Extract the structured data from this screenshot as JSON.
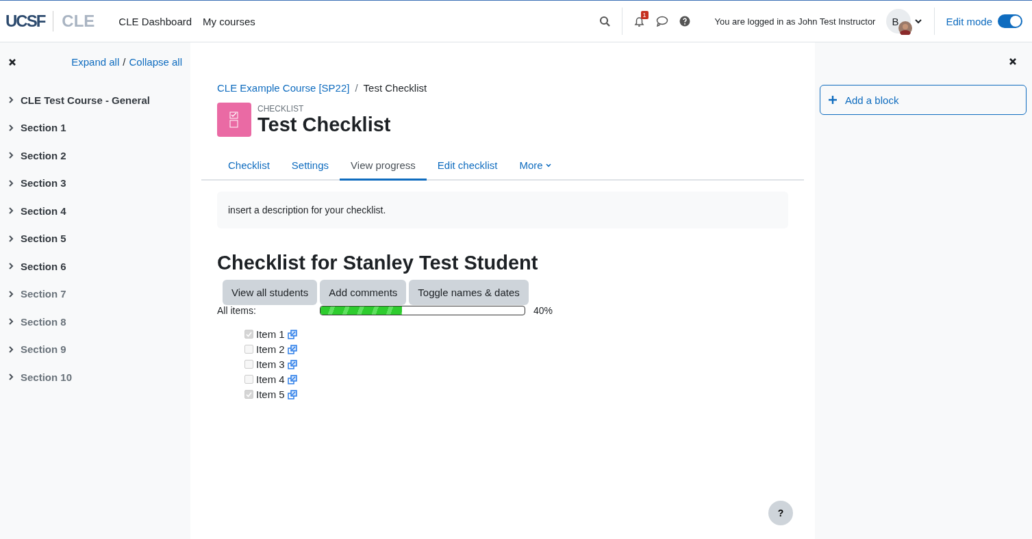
{
  "header": {
    "logo": "UCSF",
    "logo_product": "CLE",
    "nav": [
      "CLE Dashboard",
      "My courses"
    ],
    "notification_count": "1",
    "logged_in_text": "You are logged in as John Test Instructor",
    "avatar_initials": "B",
    "edit_mode": {
      "label": "Edit mode",
      "on": true
    }
  },
  "course_index": {
    "expand_all": "Expand all",
    "separator": "/",
    "collapse_all": "Collapse all",
    "sections": [
      {
        "title": "CLE Test Course - General",
        "hidden": false
      },
      {
        "title": "Section 1",
        "hidden": false
      },
      {
        "title": "Section 2",
        "hidden": false
      },
      {
        "title": "Section 3",
        "hidden": false
      },
      {
        "title": "Section 4",
        "hidden": false
      },
      {
        "title": "Section 5",
        "hidden": false
      },
      {
        "title": "Section 6",
        "hidden": false
      },
      {
        "title": "Section 7",
        "hidden": true
      },
      {
        "title": "Section 8",
        "hidden": true
      },
      {
        "title": "Section 9",
        "hidden": true
      },
      {
        "title": "Section 10",
        "hidden": true
      }
    ]
  },
  "breadcrumb": {
    "link": "CLE Example Course [SP22]",
    "separator": "/",
    "current": "Test Checklist"
  },
  "activity": {
    "type": "CHECKLIST",
    "title": "Test Checklist"
  },
  "tabs": [
    {
      "label": "Checklist",
      "selected": false
    },
    {
      "label": "Settings",
      "selected": false
    },
    {
      "label": "View progress",
      "selected": true
    },
    {
      "label": "Edit checklist",
      "selected": false
    },
    {
      "label": "More",
      "selected": false
    }
  ],
  "description": "insert a description for your checklist.",
  "checklist": {
    "heading": "Checklist for Stanley Test Student",
    "buttons": [
      "View all students",
      "Add comments",
      "Toggle names & dates"
    ],
    "progress_label": "All items:",
    "level": 0.4,
    "progress_reading": "40%",
    "items": [
      {
        "label": "Item 1",
        "checked": true
      },
      {
        "label": "Item 2",
        "checked": false
      },
      {
        "label": "Item 3",
        "checked": false
      },
      {
        "label": "Item 4",
        "checked": false
      },
      {
        "label": "Item 5",
        "checked": true
      }
    ]
  },
  "blocks": {
    "add_block": "Add a block"
  },
  "help_button": "?"
}
